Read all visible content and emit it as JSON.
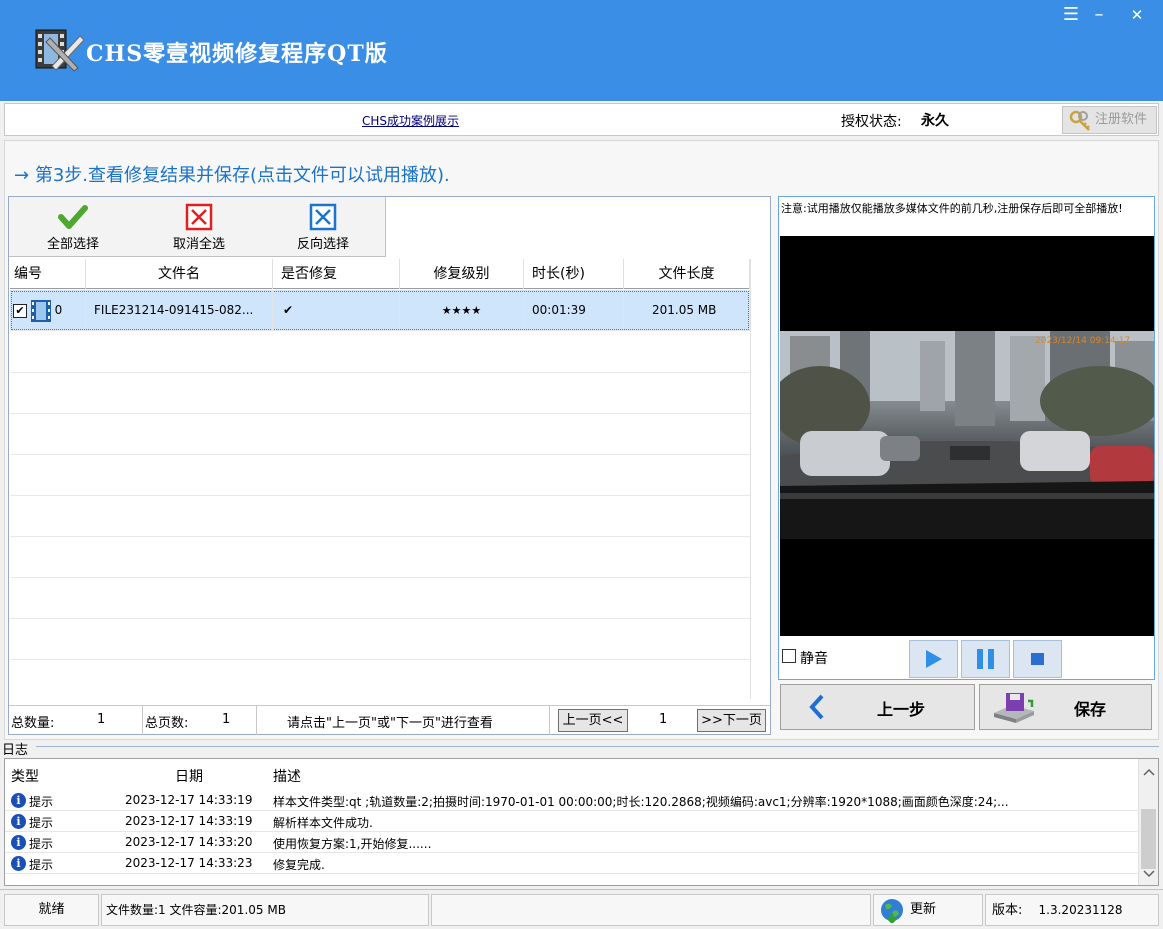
{
  "window": {
    "title": "CHS零壹视频修复程序QT版",
    "controls": {
      "menu": "☰",
      "minimize": "–",
      "close": "✕"
    }
  },
  "topbar": {
    "case_link": "CHS成功案例展示",
    "license_label": "授权状态:",
    "license_value": "永久",
    "register_button": "注册软件"
  },
  "step": {
    "arrow": "→",
    "title": "第3步.查看修复结果并保存(点击文件可以试用播放)."
  },
  "toolbar": {
    "select_all": "全部选择",
    "deselect_all": "取消全选",
    "invert_select": "反向选择"
  },
  "table": {
    "columns": [
      "编号",
      "文件名",
      "是否修复",
      "修复级别",
      "时长(秒)",
      "文件长度"
    ],
    "rows": [
      {
        "index": "0",
        "filename": "FILE231214-091415-082...",
        "repaired": "✔",
        "level": "★★★★",
        "duration": "00:01:39",
        "size": "201.05 MB"
      }
    ]
  },
  "pager": {
    "total_label": "总数量:",
    "total_value": "1",
    "pages_label": "总页数:",
    "pages_value": "1",
    "hint": "请点击\"上一页\"或\"下一页\"进行查看",
    "prev": "上一页<<",
    "current_page": "1",
    "next": ">>下一页"
  },
  "preview": {
    "note": "注意:试用播放仅能播放多媒体文件的前几秒,注册保存后即可全部播放!",
    "mute_label": "静音",
    "timestamp_overlay": "2023/12/14 09:14:17"
  },
  "nav": {
    "back": "上一步",
    "save": "保存"
  },
  "log": {
    "title": "日志",
    "columns": [
      "类型",
      "日期",
      "描述"
    ],
    "rows": [
      {
        "type": "提示",
        "date": "2023-12-17 14:33:19",
        "desc": "样本文件类型:qt ;轨道数量:2;拍摄时间:1970-01-01 00:00:00;时长:120.2868;视频编码:avc1;分辨率:1920*1088;画面颜色深度:24;..."
      },
      {
        "type": "提示",
        "date": "2023-12-17 14:33:19",
        "desc": "解析样本文件成功."
      },
      {
        "type": "提示",
        "date": "2023-12-17 14:33:20",
        "desc": "使用恢复方案:1,开始修复......"
      },
      {
        "type": "提示",
        "date": "2023-12-17 14:33:23",
        "desc": "修复完成."
      }
    ]
  },
  "statusbar": {
    "state": "就绪",
    "file_info": "文件数量:1 文件容量:201.05 MB",
    "update": "更新",
    "version_label": "版本:",
    "version_value": "1.3.20231128"
  },
  "colors": {
    "titlebar": "#3a8ee6",
    "step_text": "#1a72c9",
    "selection": "#cfe5fb",
    "info_icon": "#1a4fb5"
  }
}
